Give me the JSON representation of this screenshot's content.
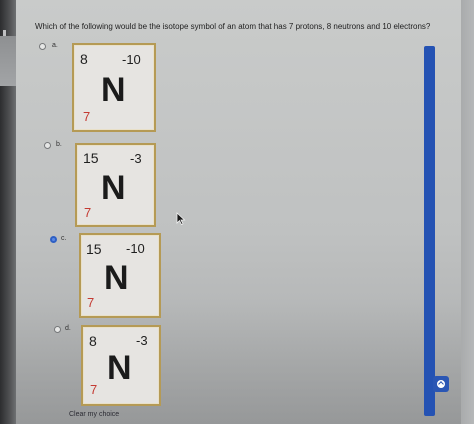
{
  "question": {
    "text": "Which of the following would be the isotope symbol of an atom that has 7 protons, 8 neutrons and 10 electrons?"
  },
  "options": [
    {
      "letter": "a.",
      "mass": "8",
      "charge": "-10",
      "symbol": "N",
      "atomic_number": "7",
      "selected": false
    },
    {
      "letter": "b.",
      "mass": "15",
      "charge": "-3",
      "symbol": "N",
      "atomic_number": "7",
      "selected": false
    },
    {
      "letter": "c.",
      "mass": "15",
      "charge": "-10",
      "symbol": "N",
      "atomic_number": "7",
      "selected": true
    },
    {
      "letter": "d.",
      "mass": "8",
      "charge": "-3",
      "symbol": "N",
      "atomic_number": "7",
      "selected": false
    }
  ],
  "clear_choice_label": "Clear my choice",
  "colors": {
    "accent": "#2452b3",
    "card_border": "#b59a55",
    "atomic_number": "#c43a32"
  },
  "icons": {
    "cursor": "mouse-pointer-icon",
    "scroll_button": "chevron-up-icon"
  }
}
